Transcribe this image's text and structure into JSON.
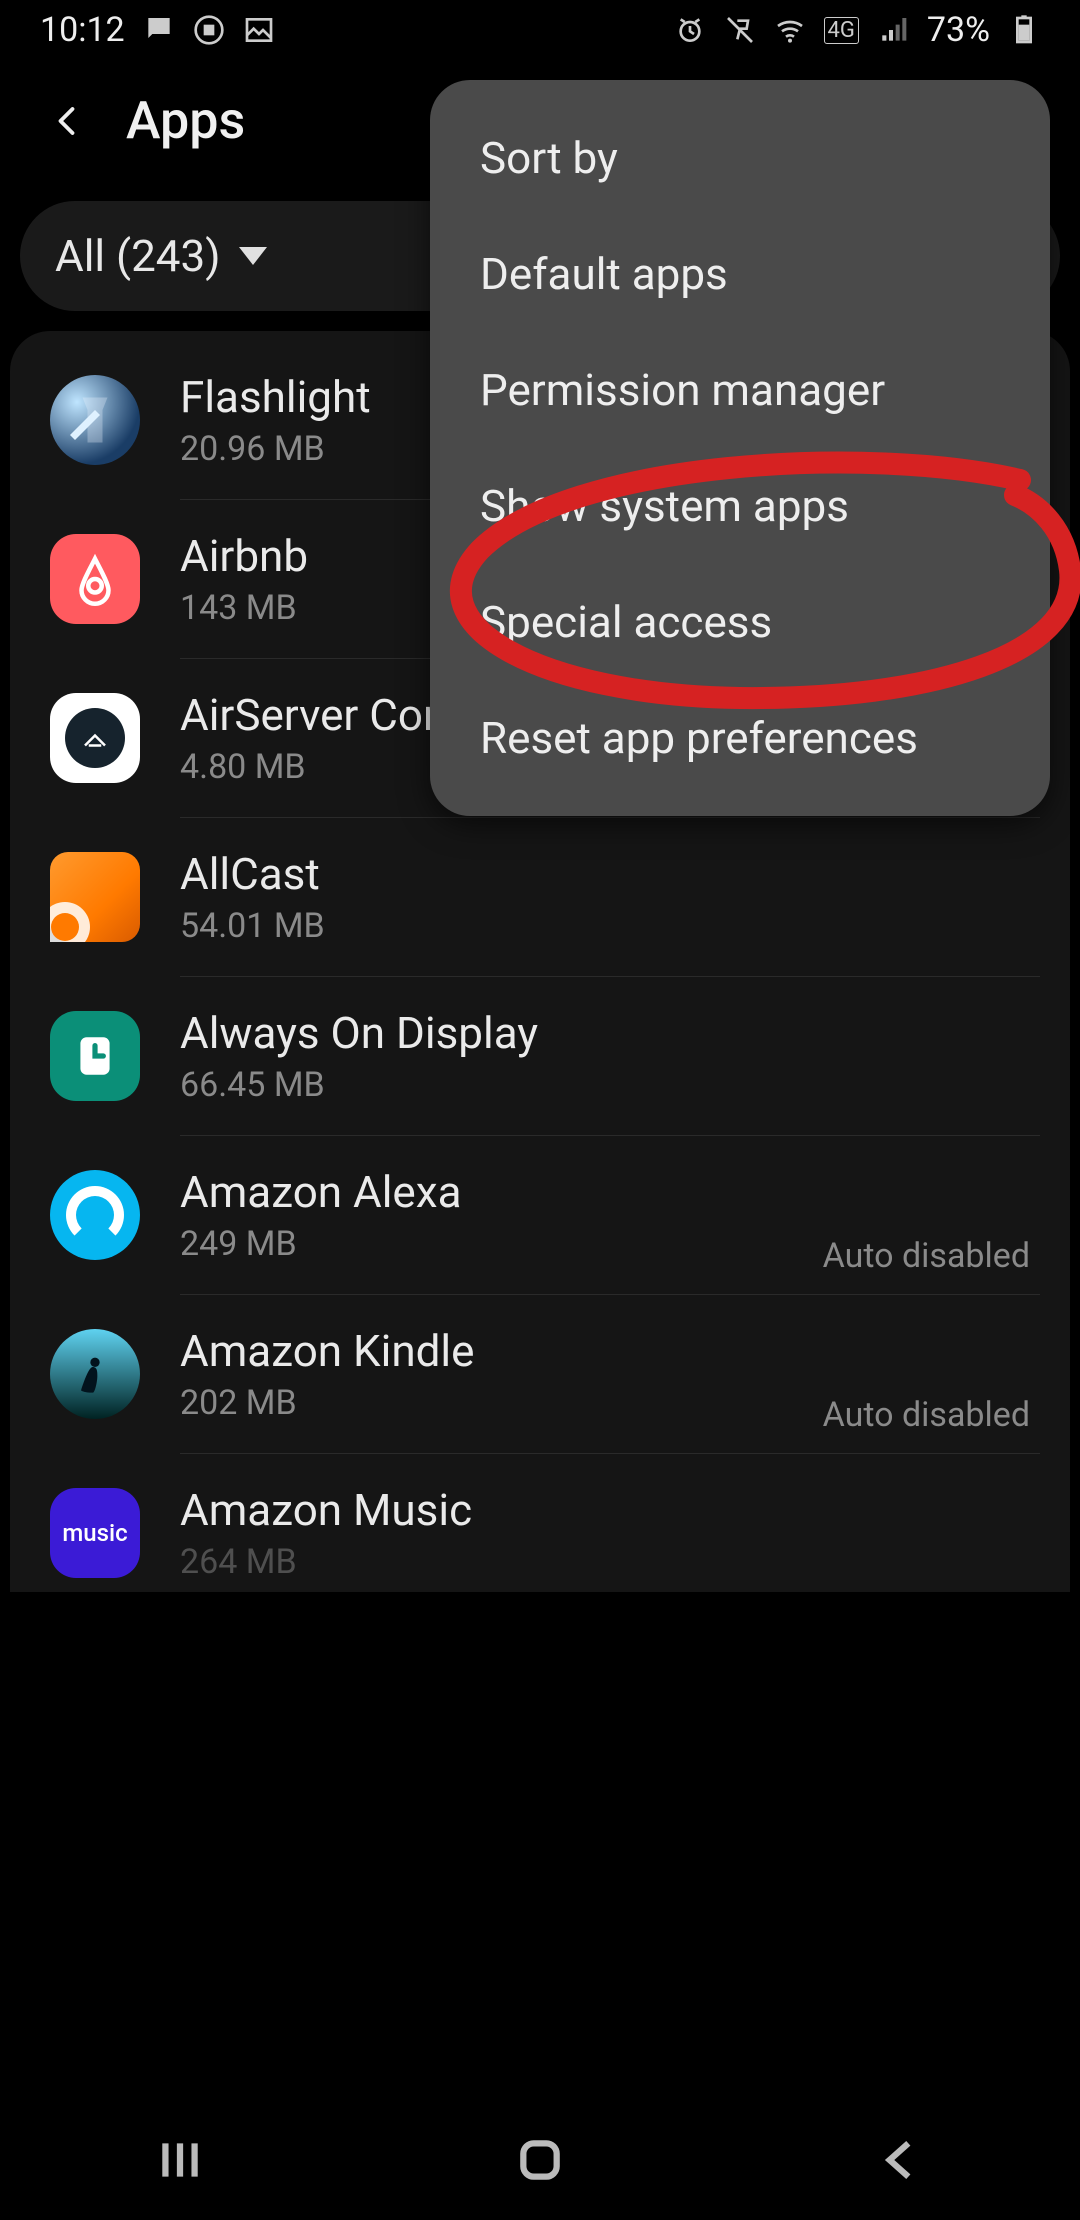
{
  "statusbar": {
    "time": "10:12",
    "battery": "73%"
  },
  "header": {
    "title": "Apps"
  },
  "filter": {
    "label": "All (243)"
  },
  "menu": {
    "items": [
      "Sort by",
      "Default apps",
      "Permission manager",
      "Show system apps",
      "Special access",
      "Reset app preferences"
    ],
    "highlighted_index": 3
  },
  "apps": [
    {
      "name": "Flashlight",
      "size": "20.96 MB",
      "tag": ""
    },
    {
      "name": "Airbnb",
      "size": "143 MB",
      "tag": ""
    },
    {
      "name": "AirServer Connect",
      "size": "4.80 MB",
      "tag": ""
    },
    {
      "name": "AllCast",
      "size": "54.01 MB",
      "tag": ""
    },
    {
      "name": "Always On Display",
      "size": "66.45 MB",
      "tag": ""
    },
    {
      "name": "Amazon Alexa",
      "size": "249 MB",
      "tag": "Auto disabled"
    },
    {
      "name": "Amazon Kindle",
      "size": "202 MB",
      "tag": "Auto disabled"
    },
    {
      "name": "Amazon Music",
      "size": "264 MB",
      "tag": ""
    }
  ],
  "icons": {
    "music_label": "music"
  }
}
